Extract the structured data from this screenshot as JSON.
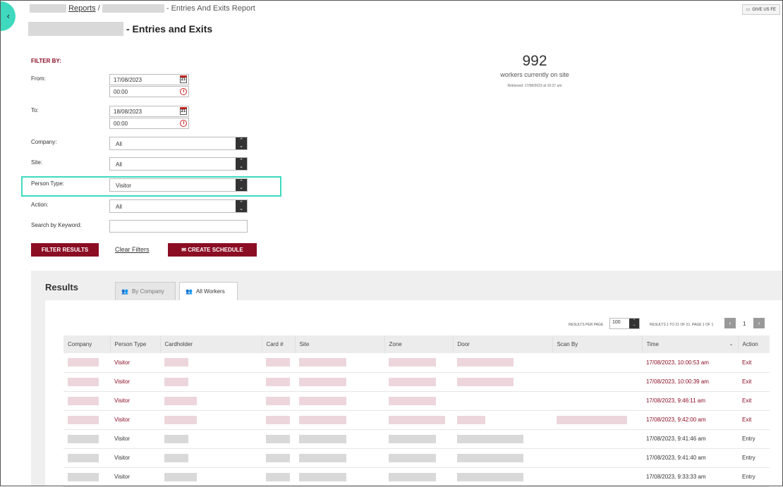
{
  "breadcrumb": {
    "reports_link": "Reports",
    "separator": "/",
    "current": "- Entries And Exits Report"
  },
  "header": {
    "title": "- Entries and Exits",
    "feedback_label": "GIVE US FE"
  },
  "filters": {
    "heading": "FILTER BY:",
    "from_label": "From:",
    "from_date": "17/08/2023",
    "from_time": "00:00",
    "to_label": "To:",
    "to_date": "18/08/2023",
    "to_time": "00:00",
    "calendar_day": "21",
    "company_label": "Company:",
    "company_value": "All",
    "site_label": "Site:",
    "site_value": "All",
    "person_type_label": "Person Type:",
    "person_type_value": "Visitor",
    "action_label": "Action:",
    "action_value": "All",
    "keyword_label": "Search by Keyword:",
    "keyword_value": "",
    "filter_button": "FILTER RESULTS",
    "clear_link": "Clear Filters",
    "schedule_button": "CREATE SCHEDULE"
  },
  "stats": {
    "count": "992",
    "label": "workers currently on site",
    "retrieved": "Retrieved: 17/08/2023 at 10:27 am"
  },
  "results": {
    "title": "Results",
    "tabs": [
      {
        "label": "By Company"
      },
      {
        "label": "All Workers"
      }
    ],
    "per_page_label": "RESULTS PER PAGE",
    "per_page_value": "100",
    "count_text": "RESULTS 1 TO 21 OF 21. PAGE 1 OF 1",
    "page_number": "1",
    "columns": [
      "Company",
      "Person Type",
      "Cardholder",
      "Card #",
      "Site",
      "Zone",
      "Door",
      "Scan By",
      "Time",
      "Action"
    ],
    "rows": [
      {
        "person_type": "Visitor",
        "time": "17/08/2023, 10:00:53 am",
        "action": "Exit"
      },
      {
        "person_type": "Visitor",
        "time": "17/08/2023, 10:00:39 am",
        "action": "Exit"
      },
      {
        "person_type": "Visitor",
        "time": "17/08/2023, 9:46:11 am",
        "action": "Exit"
      },
      {
        "person_type": "Visitor",
        "time": "17/08/2023, 9:42:00 am",
        "action": "Exit"
      },
      {
        "person_type": "Visitor",
        "time": "17/08/2023, 9:41:46 am",
        "action": "Entry"
      },
      {
        "person_type": "Visitor",
        "time": "17/08/2023, 9:41:40 am",
        "action": "Entry"
      },
      {
        "person_type": "Visitor",
        "time": "17/08/2023, 9:33:33 am",
        "action": "Entry"
      }
    ]
  },
  "colors": {
    "brand": "#8b0d24",
    "accent": "#3fd9bf"
  }
}
